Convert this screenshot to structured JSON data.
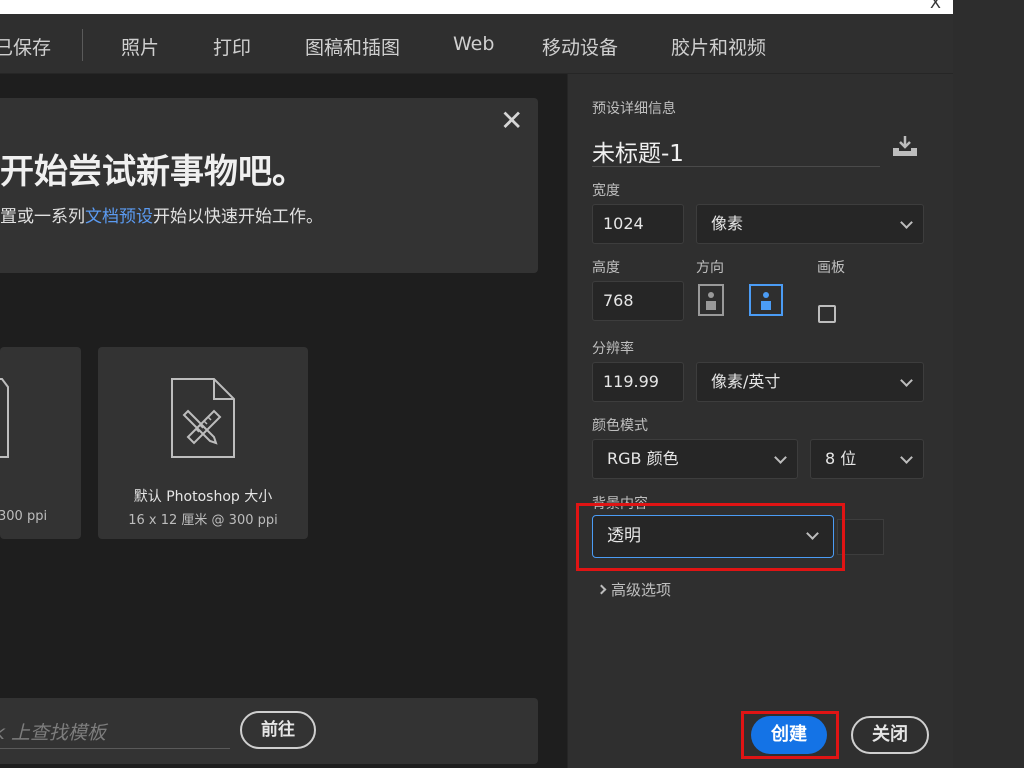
{
  "titlebar": {
    "close": "X"
  },
  "tabs": [
    {
      "label": "已保存"
    },
    {
      "label": "照片"
    },
    {
      "label": "打印"
    },
    {
      "label": "图稿和插图"
    },
    {
      "label": "Web"
    },
    {
      "label": "移动设备"
    },
    {
      "label": "胶片和视频"
    }
  ],
  "banner": {
    "headline": "开始尝试新事物吧。",
    "sub_prefix": "置或一系列",
    "sub_link": "文档预设",
    "sub_suffix": "开始以快速开始工作。"
  },
  "presets": [
    {
      "name": "",
      "meta": "300 ppi"
    },
    {
      "name": "默认 Photoshop 大小",
      "meta": "16 x 12 厘米 @ 300 ppi"
    }
  ],
  "search": {
    "placeholder": "k 上查找模板",
    "go": "前往"
  },
  "details": {
    "section_title": "预设详细信息",
    "doc_name": "未标题-1",
    "width_label": "宽度",
    "width_value": "1024",
    "width_unit": "像素",
    "height_label": "高度",
    "height_value": "768",
    "orientation_label": "方向",
    "artboard_label": "画板",
    "resolution_label": "分辨率",
    "resolution_value": "119.99",
    "resolution_unit": "像素/英寸",
    "color_mode_label": "颜色模式",
    "color_mode": "RGB 颜色",
    "bit_depth": "8 位",
    "background_label": "背景内容",
    "background_value": "透明",
    "advanced": "高级选项",
    "create": "创建",
    "close": "关闭"
  },
  "colors": {
    "accent": "#1473e6",
    "highlight": "#e01414",
    "link": "#5b9bf2"
  }
}
